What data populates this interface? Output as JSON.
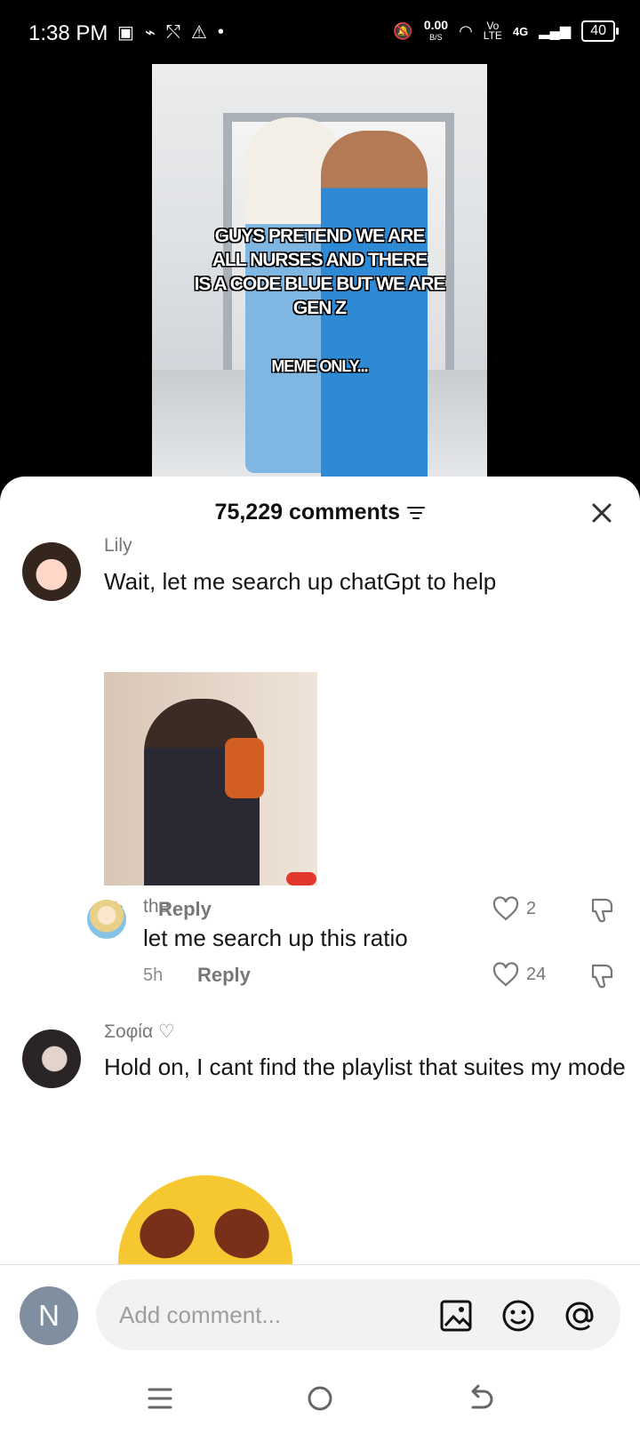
{
  "status_bar": {
    "time": "1:38 PM",
    "speed": "0.00",
    "speed_unit": "B/S",
    "volte": "Vo",
    "lte": "LTE",
    "network": "4G",
    "battery": "40"
  },
  "video": {
    "caption_lines": [
      "GUYS PRETEND WE ARE",
      "ALL NURSES AND THERE",
      "IS A CODE BLUE BUT WE ARE",
      "GEN Z"
    ],
    "sub_caption": "MEME ONLY..."
  },
  "comments_header": {
    "count": "75,229 comments"
  },
  "comments": [
    {
      "username": "Lily",
      "text": "Wait, let me search up chatGpt to help",
      "time": "5h",
      "reply_label": "Reply",
      "likes": "2"
    },
    {
      "username": "the",
      "text": "let me search up this ratio",
      "time": "5h",
      "reply_label": "Reply",
      "likes": "24"
    },
    {
      "username": "Σοφία ♡",
      "text": "Hold on, I cant find the playlist that suites my mode"
    }
  ],
  "composer": {
    "avatar_letter": "N",
    "placeholder": "Add comment..."
  },
  "icons": {
    "close": "close-icon",
    "filter": "filter-icon",
    "like": "heart-icon",
    "dislike": "thumbs-down-icon",
    "image": "image-icon",
    "emoji": "emoji-icon",
    "mention": "at-icon"
  },
  "colors": {
    "sheet": "#ffffff",
    "text": "#161616",
    "muted": "#777777"
  }
}
